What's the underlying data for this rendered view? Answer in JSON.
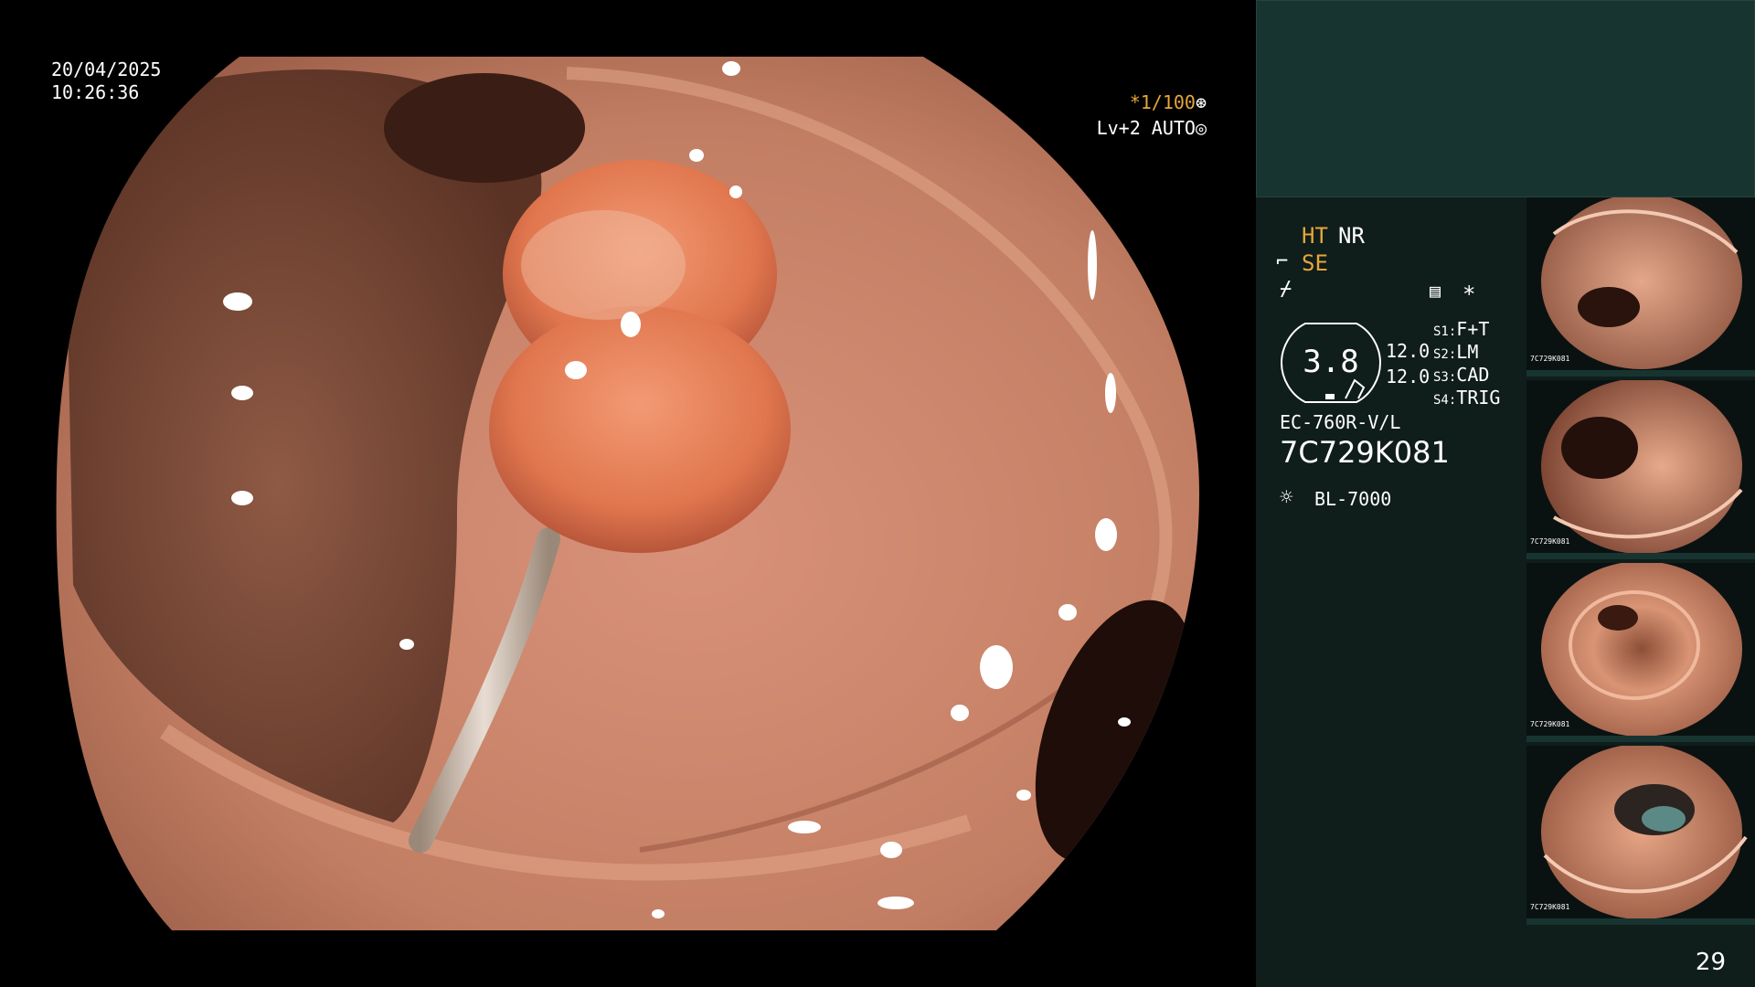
{
  "overlay": {
    "date": "20/04/2025",
    "time": "10:26:36",
    "shutter_prefix": "*1/100",
    "shutter_icon": "aperture-icon",
    "level": "Lv+2 AUTO",
    "level_icon": "iris-icon"
  },
  "panel": {
    "ht": "HT",
    "nr": "NR",
    "se": "SE",
    "se_icon": "scope-tip-icon",
    "freeze_icon": "freeze-icon",
    "memo_icon": "memo-icon",
    "star": "*",
    "zoom": "3.8",
    "enh_top": "12.0",
    "enh_bottom": "12.0",
    "switches": [
      {
        "key": "S1:",
        "value": "F+T"
      },
      {
        "key": "S2:",
        "value": "LM"
      },
      {
        "key": "S3:",
        "value": "CAD"
      },
      {
        "key": "S4:",
        "value": "TRIG"
      }
    ],
    "scope_model": "EC-760R-V/L",
    "scope_serial": "7C729K081",
    "light_icon": "light-source-icon",
    "light_source": "BL-7000",
    "page_number": "29"
  },
  "thumbnails": [
    {
      "label": "7C729K081",
      "index": "28"
    },
    {
      "label": "7C729K081",
      "index": "27"
    },
    {
      "label": "7C729K081",
      "index": "26"
    },
    {
      "label": "7C729K081",
      "index": "25"
    }
  ],
  "colors": {
    "accent_yellow": "#e6a63a",
    "panel_bg": "#0f1d1b",
    "panel_top_bg": "#183430",
    "tissue": "#c98a6a"
  }
}
